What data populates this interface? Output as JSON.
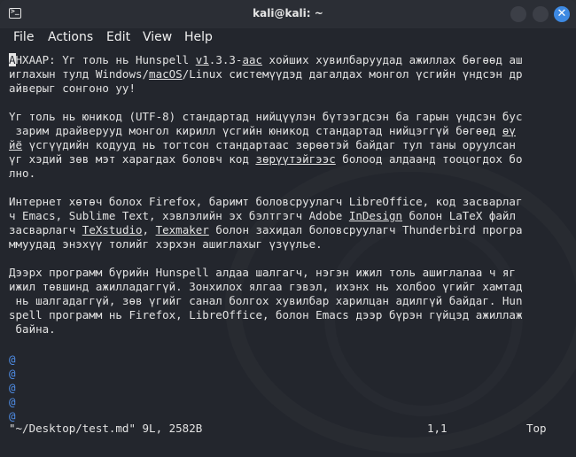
{
  "window": {
    "title": "kali@kali: ~",
    "close_glyph": "✕",
    "prompt_glyph": ">_"
  },
  "menu": [
    "File",
    "Actions",
    "Edit",
    "View",
    "Help"
  ],
  "editor": {
    "cursor_char": "А",
    "lines": [
      [
        {
          "t": "НХААР: Үг толь нь Hunspell "
        },
        {
          "t": "v1",
          "u": true
        },
        {
          "t": ".3.3-"
        },
        {
          "t": "aac",
          "u": true
        },
        {
          "t": " хойших хувилбаруудад ажиллах бөгөөд аш"
        }
      ],
      [
        {
          "t": "иглахын тулд Windows/"
        },
        {
          "t": "macOS",
          "u": true
        },
        {
          "t": "/Linux системүүдэд дагалдах монгол үсгийн үндсэн др"
        }
      ],
      [
        {
          "t": "айверыг сонгоно уу!"
        }
      ],
      [],
      [
        {
          "t": "Үг толь нь юникод (UTF-8) стандартад нийцүүлэн бүтээгдсэн ба гарын үндсэн бус"
        }
      ],
      [
        {
          "t": " зарим драйверууд монгол кирилл үсгийн юникод стандартад нийцэггүй бөгөөд "
        },
        {
          "t": "өү",
          "u": true
        }
      ],
      [
        {
          "t": "йё",
          "u": true
        },
        {
          "t": " үсгүүдийн кодууд нь тогтсон стандартаас зөрөөтэй байдаг тул таны оруулсан"
        }
      ],
      [
        {
          "t": "үг хэдий зөв мэт харагдах боловч код "
        },
        {
          "t": "зөрүүтэйгээс",
          "u": true
        },
        {
          "t": " болоод алдаанд тооцогдох бо"
        }
      ],
      [
        {
          "t": "лно."
        }
      ],
      [],
      [
        {
          "t": "Интернет хөтөч болох Firefox, баримт боловсруулагч LibreOffice, код засварлаг"
        }
      ],
      [
        {
          "t": "ч Emacs, Sublime Text, хэвлэлийн эх бэлтгэгч Adobe "
        },
        {
          "t": "InDesign",
          "u": true
        },
        {
          "t": " болон LaTeX файл"
        }
      ],
      [
        {
          "t": "засварлагч "
        },
        {
          "t": "TeXstudio",
          "u": true
        },
        {
          "t": ", "
        },
        {
          "t": "Texmaker",
          "u": true
        },
        {
          "t": " болон захидал боловсруулагч Thunderbird програ"
        }
      ],
      [
        {
          "t": "ммуудад энэхүү толийг хэрхэн ашиглахыг үзүүлье."
        }
      ],
      [],
      [
        {
          "t": "Дээрх программ бүрийн Hunspell алдаа шалгагч, нэгэн ижил толь ашиглалаа ч яг"
        }
      ],
      [
        {
          "t": "ижил төвшинд ажилладаггүй. Зонхилох ялгаа гэвэл, ихэнх нь холбоо үгийг хамтад"
        }
      ],
      [
        {
          "t": " нь шалгадаггүй, зөв үгийг санал болгох хувилбар харилцан адилгүй байдаг. Hun"
        }
      ],
      [
        {
          "t": "spell программ нь Firefox, LibreOffice, болон Emacs дээр бүрэн гүйцэд ажиллаж"
        }
      ],
      [
        {
          "t": " байна."
        }
      ]
    ],
    "tildes": [
      "@",
      "@",
      "@",
      "@",
      "@"
    ],
    "status": {
      "file": "\"~/Desktop/test.md\" 9L, 2582B",
      "position": "1,1",
      "scroll": "Top"
    }
  },
  "colors": {
    "background": "#23262d",
    "text": "#e2e2e2",
    "tilde": "#4f8ee8",
    "close_button": "#3d89e2"
  }
}
